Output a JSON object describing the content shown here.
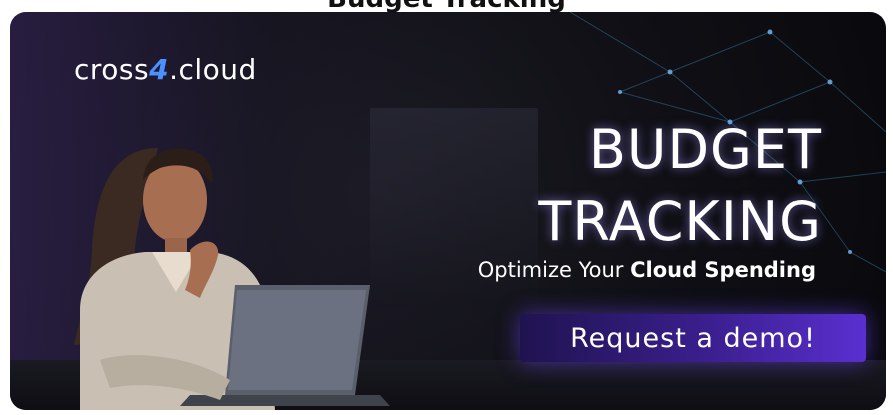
{
  "top_text": "Budget Tracking",
  "banner": {
    "logo": {
      "prefix": "cross",
      "four": "4",
      "suffix": ".cloud"
    },
    "headline_line1": "BUDGET",
    "headline_line2": "TRACKING",
    "subline_regular": "Optimize Your",
    "subline_bold": "Cloud Spending",
    "cta_label": "Request a demo!"
  },
  "colors": {
    "accent_blue": "#4a90ff",
    "cta_gradient_start": "#1f1350",
    "cta_gradient_end": "#5a2fd0",
    "background": "#0f0f15"
  }
}
